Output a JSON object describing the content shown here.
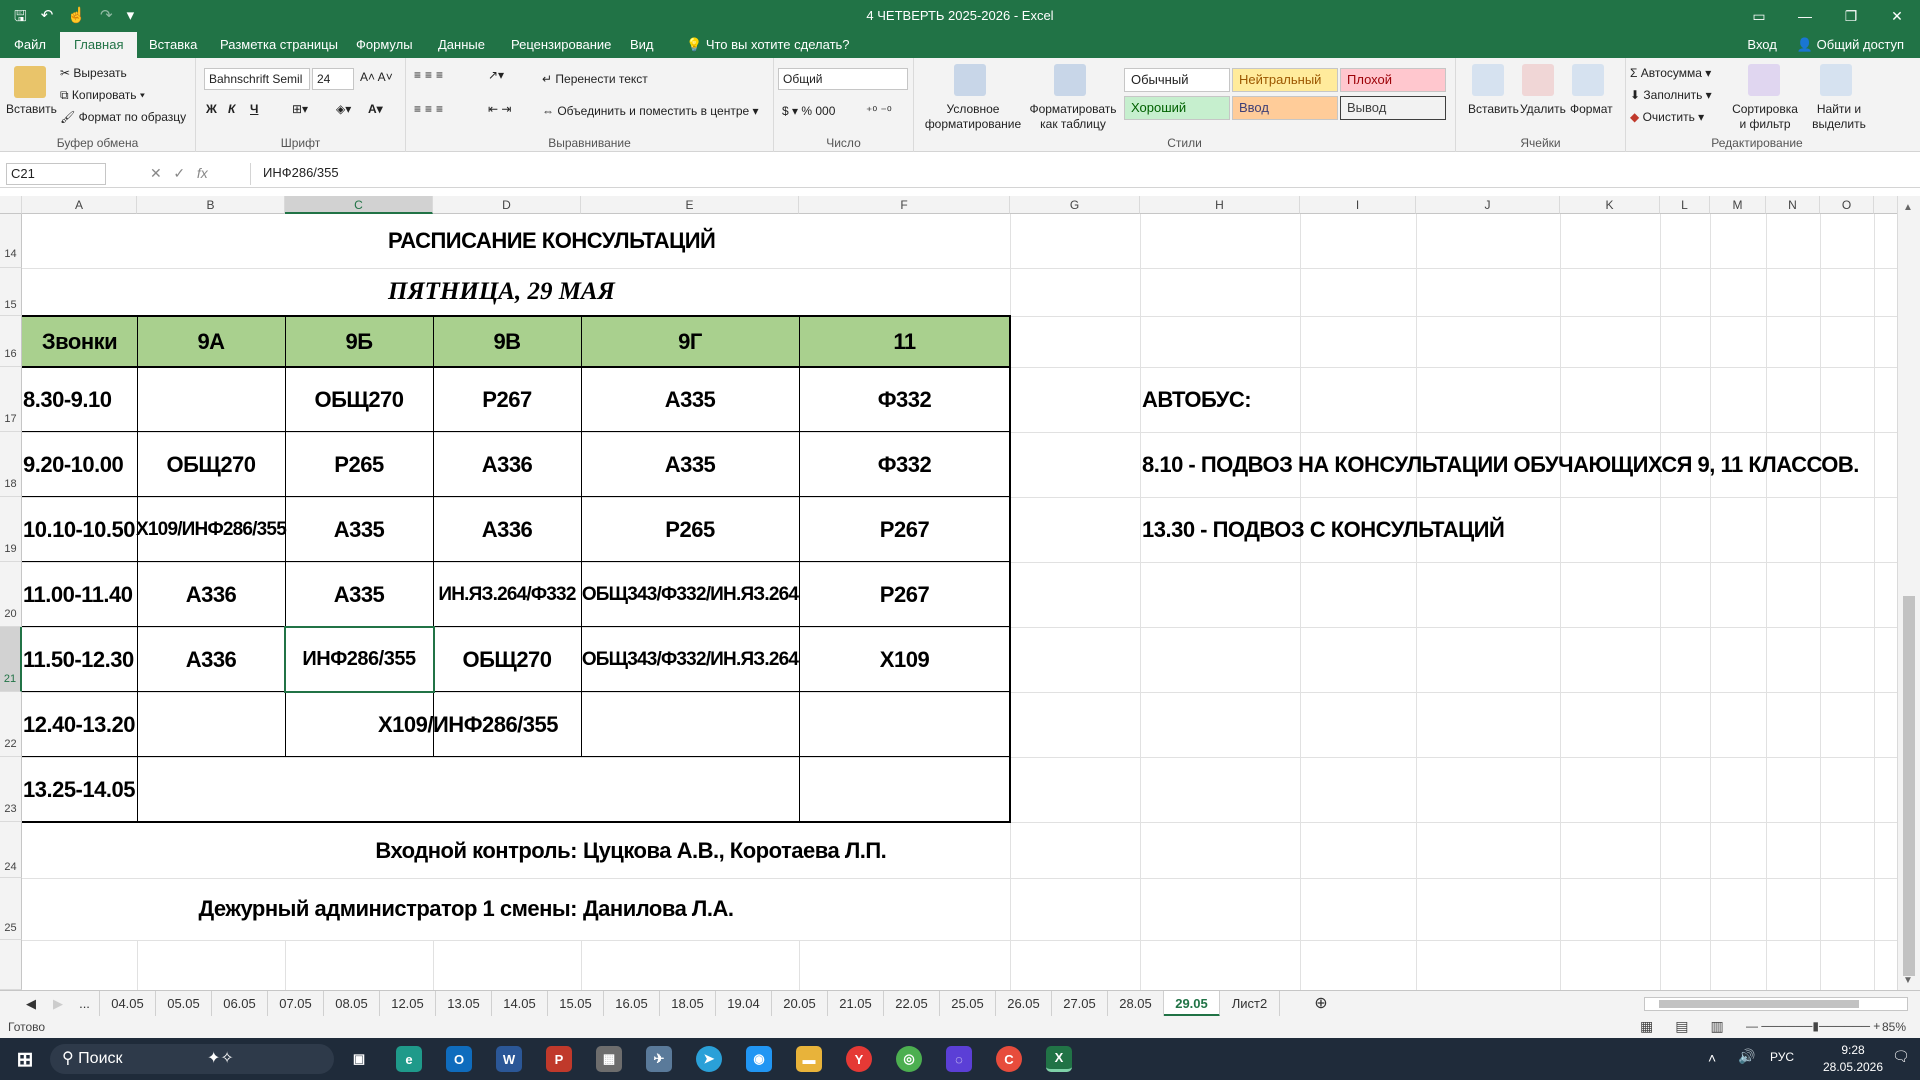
{
  "window": {
    "title": "4 ЧЕТВЕРТЬ 2025-2026 - Excel"
  },
  "menu": {
    "tabs": [
      "Файл",
      "Главная",
      "Вставка",
      "Разметка страницы",
      "Формулы",
      "Данные",
      "Рецензирование",
      "Вид"
    ],
    "search": "Что вы хотите сделать?",
    "signin": "Вход",
    "share": "Общий доступ"
  },
  "ribbon": {
    "clipboard": {
      "paste": "Вставить",
      "cut": "Вырезать",
      "copy": "Копировать",
      "format_painter": "Формат по образцу",
      "label": "Буфер обмена"
    },
    "font": {
      "name": "Bahnschrift Semil",
      "size": "24",
      "bold": "Ж",
      "italic": "К",
      "underline": "Ч",
      "label": "Шрифт"
    },
    "alignment": {
      "wrap": "Перенести текст",
      "merge": "Объединить и поместить в центре",
      "label": "Выравнивание"
    },
    "number": {
      "format": "Общий",
      "label": "Число"
    },
    "styles": {
      "conditional": "Условное форматирование",
      "as_table": "Форматировать как таблицу",
      "normal": "Обычный",
      "neutral": "Нейтральный",
      "bad": "Плохой",
      "good": "Хороший",
      "input": "Ввод",
      "output": "Вывод",
      "label": "Стили"
    },
    "cells": {
      "insert": "Вставить",
      "delete": "Удалить",
      "format": "Формат",
      "label": "Ячейки"
    },
    "editing": {
      "autosum": "Автосумма",
      "fill": "Заполнить",
      "clear": "Очистить",
      "sort": "Сортировка и фильтр",
      "find": "Найти и выделить",
      "label": "Редактирование"
    }
  },
  "formula_bar": {
    "name_box": "C21",
    "fx": "fx",
    "content": "ИНФ286/355"
  },
  "columns": [
    "A",
    "B",
    "C",
    "D",
    "E",
    "F",
    "G",
    "H",
    "I",
    "J",
    "K",
    "L",
    "M",
    "N",
    "O"
  ],
  "rows": [
    "14",
    "15",
    "16",
    "17",
    "18",
    "19",
    "20",
    "21",
    "22",
    "23",
    "24",
    "25"
  ],
  "sheet": {
    "title": "РАСПИСАНИЕ КОНСУЛЬТАЦИЙ",
    "date": "ПЯТНИЦА, 29 МАЯ",
    "headers": [
      "Звонки",
      "9А",
      "9Б",
      "9В",
      "9Г",
      "11"
    ],
    "schedule": [
      [
        "8.30-9.10",
        "",
        "ОБЩ270",
        "Р267",
        "А335",
        "Ф332"
      ],
      [
        "9.20-10.00",
        "ОБЩ270",
        "Р265",
        "А336",
        "А335",
        "Ф332"
      ],
      [
        "10.10-10.50",
        "Х109/ИНФ286/355",
        "А335",
        "А336",
        "Р265",
        "Р267"
      ],
      [
        "11.00-11.40",
        "А336",
        "А335",
        "ИН.ЯЗ.264/Ф332",
        "ОБЩ343/Ф332/ИН.ЯЗ.264",
        "Р267"
      ],
      [
        "11.50-12.30",
        "А336",
        "ИНФ286/355",
        "ОБЩ270",
        "ОБЩ343/Ф332/ИН.ЯЗ.264",
        "Х109"
      ],
      [
        "12.40-13.20",
        "Х109/ИНФ286/355",
        "",
        "",
        "",
        ""
      ],
      [
        "13.25-14.05",
        "",
        "",
        "",
        "",
        ""
      ]
    ],
    "entrance_label": "Входной контроль:",
    "entrance_value": "Цуцкова А.В., Коротаева Л.П.",
    "admin_label": "Дежурный администратор 1 смены:",
    "admin_value": "Данилова Л.А.",
    "bus_title": "АВТОБУС:",
    "bus_line1": "8.10 - ПОДВОЗ НА КОНСУЛЬТАЦИИ ОБУЧАЮЩИХСЯ 9, 11 КЛАССОВ.",
    "bus_line2": "13.30 - ПОДВОЗ С КОНСУЛЬТАЦИЙ"
  },
  "sheet_tabs": [
    "...",
    "04.05",
    "05.05",
    "06.05",
    "07.05",
    "08.05",
    "12.05",
    "13.05",
    "14.05",
    "15.05",
    "16.05",
    "18.05",
    "19.04",
    "20.05",
    "21.05",
    "22.05",
    "25.05",
    "26.05",
    "27.05",
    "28.05",
    "29.05",
    "Лист2"
  ],
  "status": {
    "ready": "Готово",
    "zoom": "85%"
  },
  "taskbar": {
    "search": "Поиск",
    "lang": "РУС",
    "time": "9:28",
    "date": "28.05.2026"
  }
}
